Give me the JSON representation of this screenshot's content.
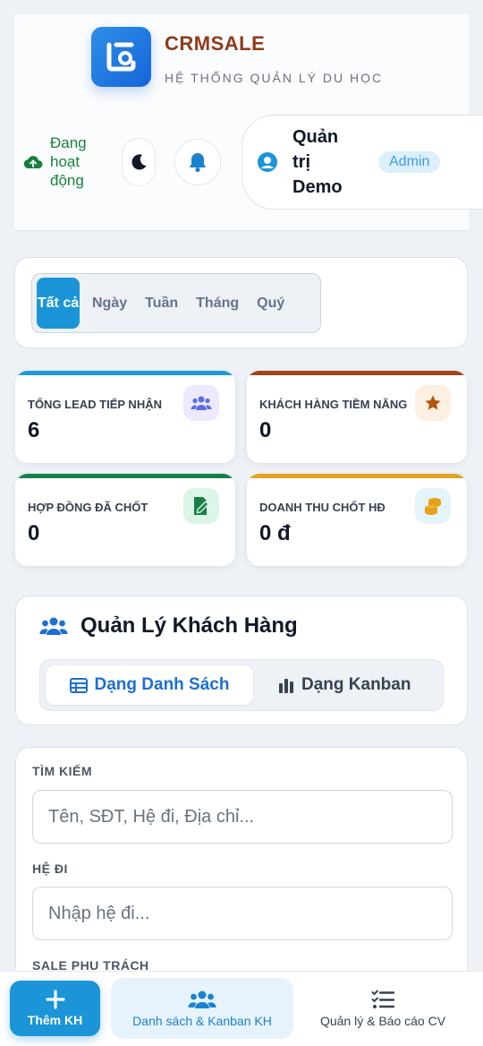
{
  "header": {
    "brand_name": "CRMSALE",
    "brand_subtitle": "HỆ THỐNG QUẢN LÝ DU HỌC",
    "status_text": "Đang hoạt động",
    "user_name": "Quản trị Demo",
    "user_role": "Admin"
  },
  "filters": {
    "tabs": [
      "Tất cả",
      "Ngày",
      "Tuần",
      "Tháng",
      "Quý"
    ],
    "active": "Tất cả"
  },
  "stats": [
    {
      "label": "TỔNG LEAD TIẾP NHẬN",
      "value": "6",
      "color": "#1e9bd7",
      "icon": "users-icon"
    },
    {
      "label": "KHÁCH HÀNG TIỀM NĂNG",
      "value": "0",
      "color": "#a0441a",
      "icon": "star-icon"
    },
    {
      "label": "HỢP ĐỒNG ĐÃ CHỐT",
      "value": "0",
      "color": "#16804c",
      "icon": "contract-icon"
    },
    {
      "label": "DOANH THU CHỐT HĐ",
      "value": "0 đ",
      "color": "#e2a321",
      "icon": "coins-icon"
    }
  ],
  "customers": {
    "title": "Quản Lý Khách Hàng",
    "view_list": "Dạng Danh Sách",
    "view_kanban": "Dạng Kanban"
  },
  "search": {
    "search_label": "TÌM KIẾM",
    "search_placeholder": "Tên, SĐT, Hệ đi, Địa chỉ...",
    "system_label": "HỆ ĐI",
    "system_placeholder": "Nhập hệ đi...",
    "sale_label": "SALE PHỤ TRÁCH"
  },
  "bottom_nav": {
    "add": "Thêm KH",
    "list": "Danh sách & Kanban KH",
    "report": "Quản lý & Báo cáo CV"
  }
}
